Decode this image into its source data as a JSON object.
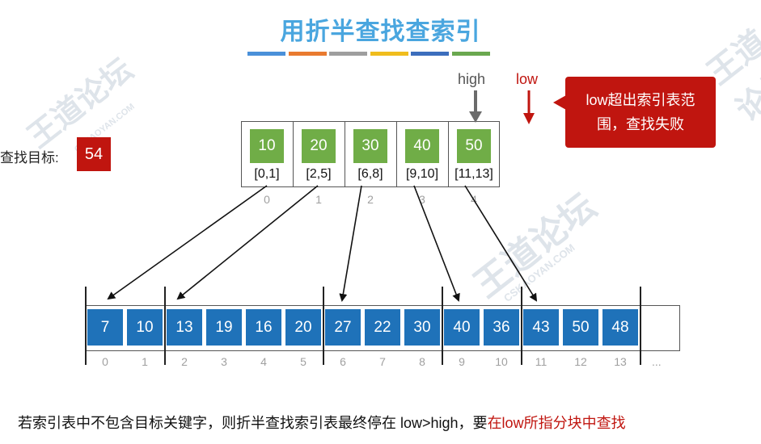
{
  "title": "用折半查找查索引",
  "title_bar_colors": [
    "#4a90d9",
    "#e97a2f",
    "#9e9e9e",
    "#f0bd1d",
    "#3c6ebd",
    "#6aa84f"
  ],
  "target": {
    "label": "查找目标:",
    "value": "54"
  },
  "index_table": {
    "keys": [
      "10",
      "20",
      "30",
      "40",
      "50"
    ],
    "ranges": [
      "[0,1]",
      "[2,5]",
      "[6,8]",
      "[9,10]",
      "[11,13]"
    ],
    "indices": [
      "0",
      "1",
      "2",
      "3",
      "4"
    ]
  },
  "pointers": {
    "high": "high",
    "low": "low"
  },
  "callout": "low超出索引表范围，查找失败",
  "main_array": {
    "values": [
      "7",
      "10",
      "13",
      "19",
      "16",
      "20",
      "27",
      "22",
      "30",
      "40",
      "36",
      "43",
      "50",
      "48"
    ],
    "indices": [
      "0",
      "1",
      "2",
      "3",
      "4",
      "5",
      "6",
      "7",
      "8",
      "9",
      "10",
      "11",
      "12",
      "13"
    ],
    "ellipsis": "..."
  },
  "bottom_text": {
    "prefix": "若索引表中不包含目标关键字，则折半查找索引表最终停在 low>high，要",
    "highlight": "在low所指分块中查找"
  },
  "watermarks": {
    "main": "王道论坛",
    "site": "CSKAOYAN.COM"
  },
  "colors": {
    "accent": "#c0150f",
    "index_key": "#70ad47",
    "array_cell": "#1f72b9",
    "title": "#4aa6df"
  }
}
